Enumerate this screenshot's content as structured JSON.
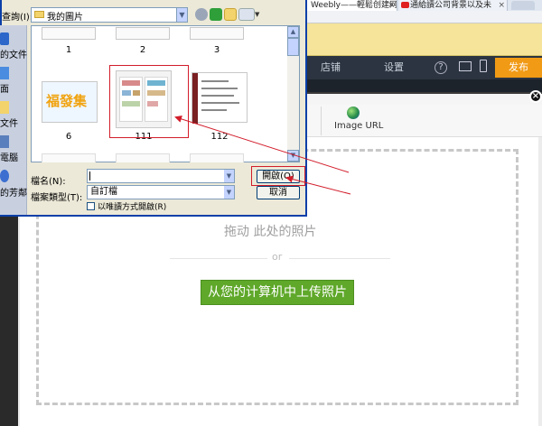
{
  "browser": {
    "tabs": [
      {
        "label": "Weebly——輕鬆创建网"
      },
      {
        "label": "通給讀公司背景以及未"
      }
    ]
  },
  "weebly": {
    "nav": {
      "store": "店铺",
      "settings": "设置",
      "help": "?",
      "publish": "发布"
    }
  },
  "modal": {
    "tabs": {
      "image_url": "Image URL"
    },
    "close": "×",
    "drag_text": "拖动 此处的照片",
    "or_text": "or",
    "upload_button": "从您的计算机中上传照片"
  },
  "dialog": {
    "look_in_label": "查詢(I):",
    "look_in_value": "我的圖片",
    "places": {
      "documents": "的文件",
      "desktop": "面",
      "files": "文件",
      "computer": "電腦",
      "network": "的芳鄰"
    },
    "thumbnails": [
      {
        "label": "1"
      },
      {
        "label": "2"
      },
      {
        "label": "3"
      },
      {
        "label": "6"
      },
      {
        "label": "111"
      },
      {
        "label": "112"
      }
    ],
    "wordart_text": "福發集",
    "file_name_label": "檔名(N):",
    "file_name_value": "",
    "file_type_label": "檔案類型(T):",
    "file_type_value": "自訂檔",
    "readonly_label": "以唯讀方式開啟(R)",
    "open_button": "開啟(O)",
    "cancel_button": "取消"
  },
  "colors": {
    "dialog_border": "#0a3fa8",
    "upload_green": "#5fa82a",
    "publish_orange": "#f19a16",
    "annotation_red": "#d21d2b"
  }
}
